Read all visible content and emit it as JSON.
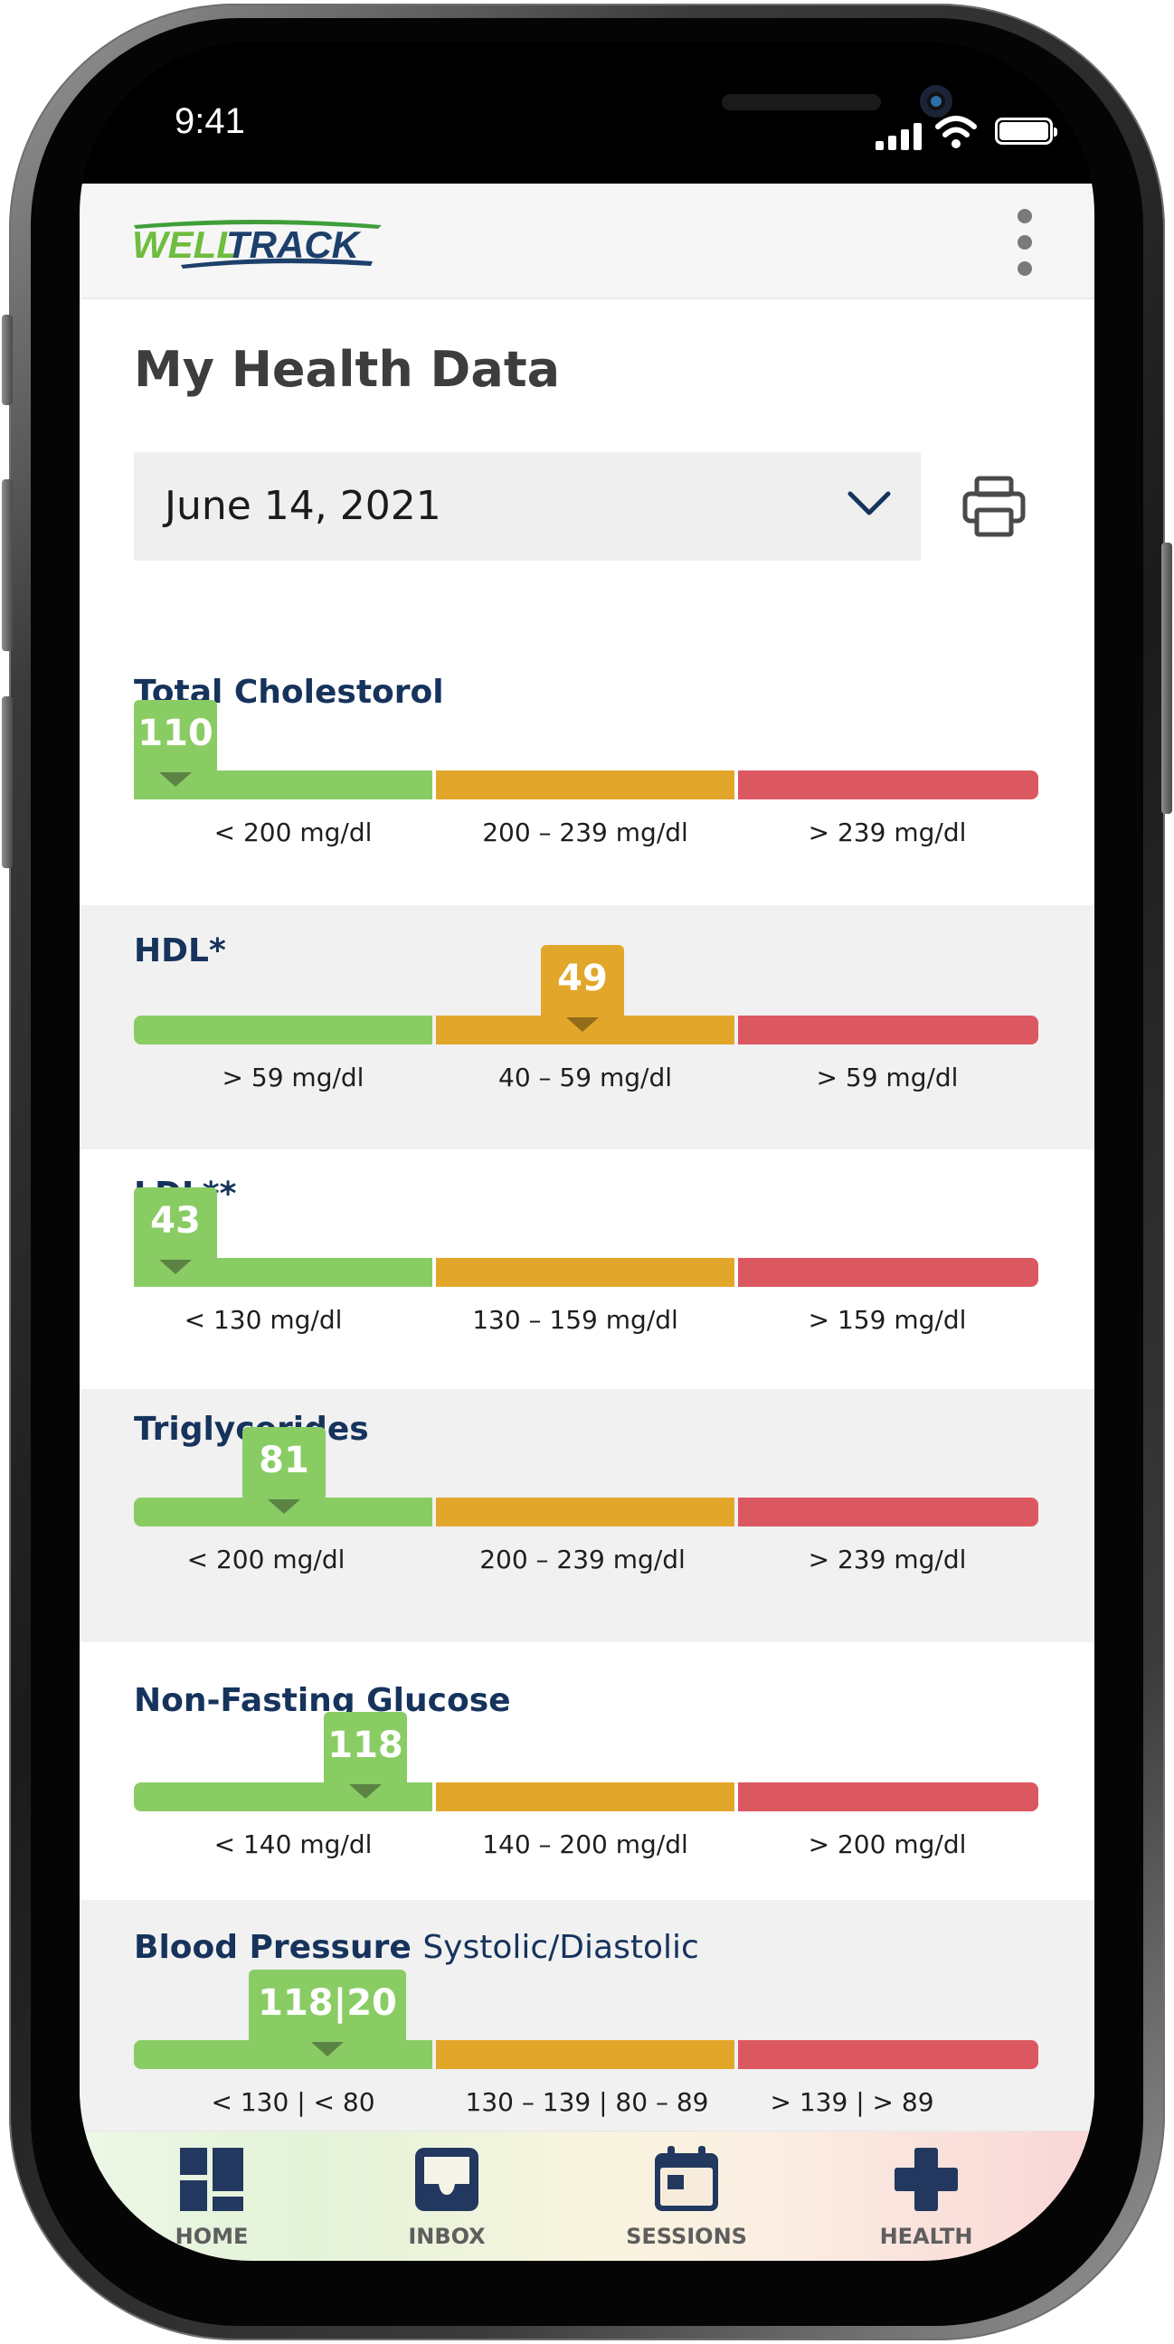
{
  "status_bar": {
    "time": "9:41"
  },
  "header": {
    "logo_left": "WELL",
    "logo_right": "TRACK",
    "menu_icon": "kebab-menu-icon"
  },
  "page": {
    "title": "My Health Data",
    "date_select": {
      "value": "June 14, 2021",
      "icon": "chevron-down-icon"
    },
    "print_icon": "print-icon"
  },
  "colors": {
    "good": "#8acc64",
    "moderate": "#e2a72a",
    "high": "#dc5861",
    "heading": "#16335c"
  },
  "metrics": [
    {
      "name": "Total Cholestorol",
      "suffix": "",
      "value": "110",
      "status": "good",
      "ranges": [
        "< 200 mg/dl",
        "200 – 239 mg/dl",
        "> 239 mg/dl"
      ]
    },
    {
      "name": "HDL*",
      "suffix": "",
      "value": "49",
      "status": "moderate",
      "ranges": [
        "> 59 mg/dl",
        "40 – 59 mg/dl",
        "> 59 mg/dl"
      ]
    },
    {
      "name": "LDL**",
      "suffix": "",
      "value": "43",
      "status": "good",
      "ranges": [
        "< 130 mg/dl",
        "130 – 159 mg/dl",
        "> 159 mg/dl"
      ]
    },
    {
      "name": "Triglycerides",
      "suffix": "",
      "value": "81",
      "status": "good",
      "ranges": [
        "< 200 mg/dl",
        "200 – 239 mg/dl",
        "> 239 mg/dl"
      ]
    },
    {
      "name": "Non-Fasting Glucose",
      "suffix": "",
      "value": "118",
      "status": "good",
      "ranges": [
        "< 140 mg/dl",
        "140 – 200 mg/dl",
        "> 200 mg/dl"
      ]
    },
    {
      "name": "Blood Pressure",
      "suffix": "Systolic/Diastolic",
      "value": "118|20",
      "status": "good",
      "ranges": [
        "< 130 | < 80",
        "130 – 139 | 80 – 89",
        "> 139 | > 89"
      ]
    }
  ],
  "bottom_nav": [
    {
      "label": "HOME",
      "icon": "dashboard-icon"
    },
    {
      "label": "INBOX",
      "icon": "inbox-icon"
    },
    {
      "label": "SESSIONS",
      "icon": "calendar-icon"
    },
    {
      "label": "HEALTH",
      "icon": "plus-icon"
    }
  ]
}
